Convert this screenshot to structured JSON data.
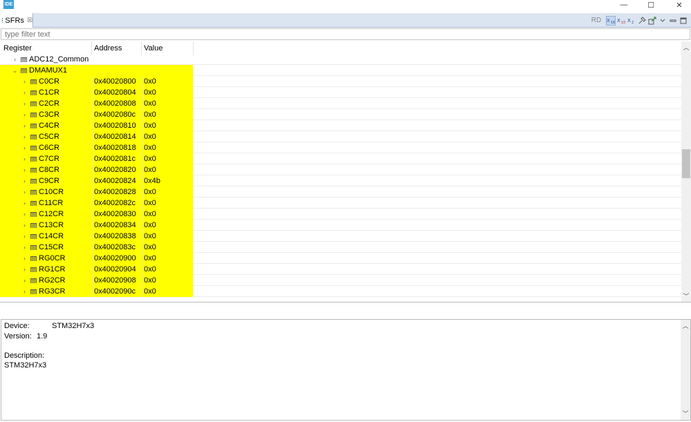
{
  "titlebar": {
    "logo_text": "IDE",
    "min_symbol": "—",
    "max_symbol": "☐",
    "close_symbol": "✕"
  },
  "tab": {
    "label": "SFRs",
    "close_symbol": "☒"
  },
  "toolbar": {
    "rd_label": "RD",
    "icons": [
      "hex-format-icon",
      "dec-format-icon",
      "bin-format-icon",
      "pin-icon",
      "export-icon",
      "view-menu-icon",
      "minimize-icon",
      "maximize-icon"
    ]
  },
  "filter": {
    "placeholder": "type filter text"
  },
  "table": {
    "headers": {
      "register": "Register",
      "address": "Address",
      "value": "Value"
    },
    "group_collapsed": "ADC12_Common",
    "group_expanded": "DMAMUX1",
    "rows": [
      {
        "name": "C0CR",
        "address": "0x40020800",
        "value": "0x0"
      },
      {
        "name": "C1CR",
        "address": "0x40020804",
        "value": "0x0"
      },
      {
        "name": "C2CR",
        "address": "0x40020808",
        "value": "0x0"
      },
      {
        "name": "C3CR",
        "address": "0x4002080c",
        "value": "0x0"
      },
      {
        "name": "C4CR",
        "address": "0x40020810",
        "value": "0x0"
      },
      {
        "name": "C5CR",
        "address": "0x40020814",
        "value": "0x0"
      },
      {
        "name": "C6CR",
        "address": "0x40020818",
        "value": "0x0"
      },
      {
        "name": "C7CR",
        "address": "0x4002081c",
        "value": "0x0"
      },
      {
        "name": "C8CR",
        "address": "0x40020820",
        "value": "0x0"
      },
      {
        "name": "C9CR",
        "address": "0x40020824",
        "value": "0x4b"
      },
      {
        "name": "C10CR",
        "address": "0x40020828",
        "value": "0x0"
      },
      {
        "name": "C11CR",
        "address": "0x4002082c",
        "value": "0x0"
      },
      {
        "name": "C12CR",
        "address": "0x40020830",
        "value": "0x0"
      },
      {
        "name": "C13CR",
        "address": "0x40020834",
        "value": "0x0"
      },
      {
        "name": "C14CR",
        "address": "0x40020838",
        "value": "0x0"
      },
      {
        "name": "C15CR",
        "address": "0x4002083c",
        "value": "0x0"
      },
      {
        "name": "RG0CR",
        "address": "0x40020900",
        "value": "0x0"
      },
      {
        "name": "RG1CR",
        "address": "0x40020904",
        "value": "0x0"
      },
      {
        "name": "RG2CR",
        "address": "0x40020908",
        "value": "0x0"
      },
      {
        "name": "RG3CR",
        "address": "0x4002090c",
        "value": "0x0"
      }
    ]
  },
  "detail": {
    "device_label": "Device:",
    "device_value": "STM32H7x3",
    "version_label": "Version:",
    "version_value": "1.9",
    "description_label": "Description:",
    "description_value": "STM32H7x3"
  },
  "colors": {
    "highlight": "#ffff00",
    "tab_strip": "#dbe5f1"
  }
}
